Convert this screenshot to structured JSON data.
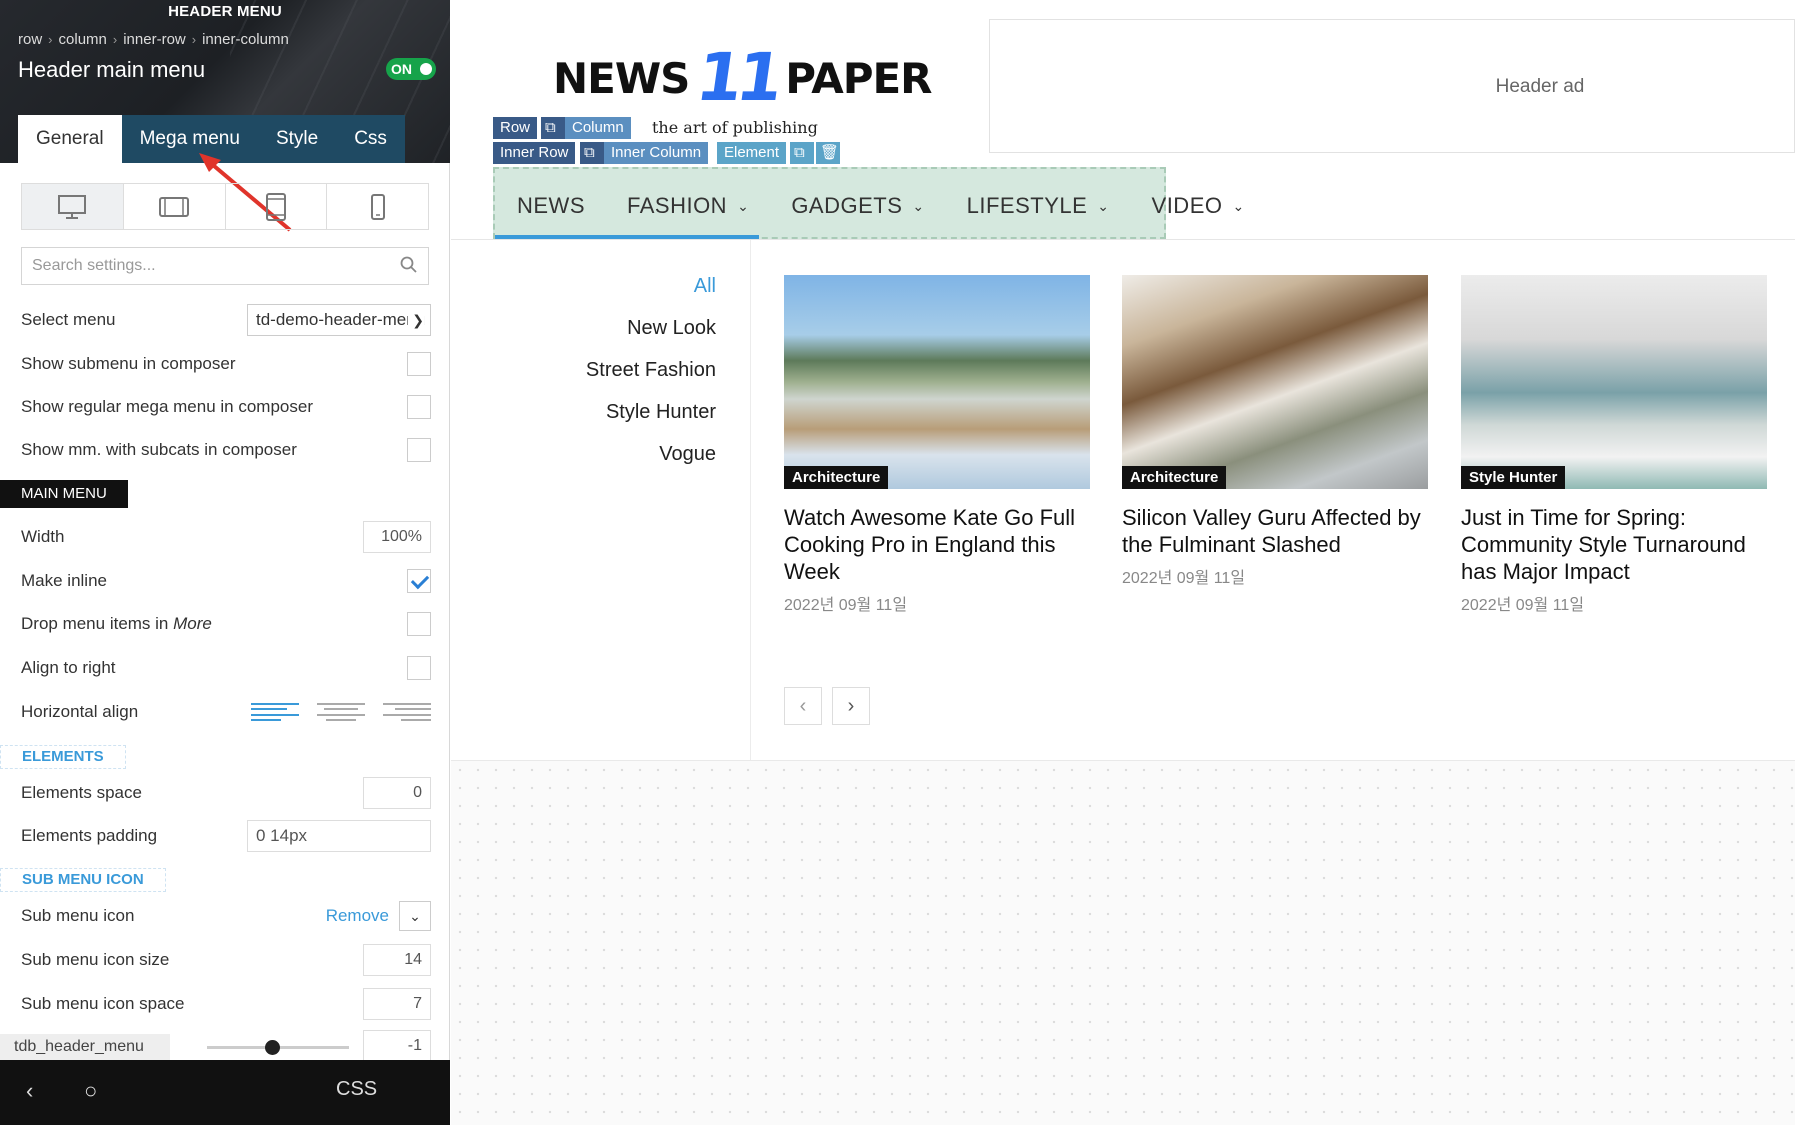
{
  "panel": {
    "header_title": "HEADER MENU",
    "breadcrumbs": [
      "row",
      "column",
      "inner-row",
      "inner-column"
    ],
    "element_name": "Header main menu",
    "toggle_label": "ON",
    "tabs": [
      {
        "label": "General",
        "active": true
      },
      {
        "label": "Mega menu",
        "active": false
      },
      {
        "label": "Style",
        "active": false
      },
      {
        "label": "Css",
        "active": false
      }
    ],
    "devices": [
      "desktop-icon",
      "tablet-landscape-icon",
      "tablet-portrait-icon",
      "phone-icon"
    ],
    "search_placeholder": "Search settings...",
    "select_menu": {
      "label": "Select menu",
      "value": "td-demo-header-menu"
    },
    "show_submenu": {
      "label": "Show submenu in composer",
      "checked": false
    },
    "show_regular_mega": {
      "label": "Show regular mega menu in composer",
      "checked": false
    },
    "show_mm_subcats": {
      "label": "Show mm. with subcats in composer",
      "checked": false
    },
    "section_main": "MAIN MENU",
    "width": {
      "label": "Width",
      "value": "100%"
    },
    "make_inline": {
      "label": "Make inline",
      "checked": true
    },
    "drop_menu_label": "Drop menu items in",
    "drop_menu_more": "More",
    "drop_menu_checked": false,
    "align_right": {
      "label": "Align to right",
      "checked": false
    },
    "horizontal_align": {
      "label": "Horizontal align",
      "selected": "left"
    },
    "section_elements": "ELEMENTS",
    "elements_space": {
      "label": "Elements space",
      "value": "0"
    },
    "elements_padding": {
      "label": "Elements padding",
      "value": "0 14px"
    },
    "section_submenu_icon": "SUB MENU ICON",
    "sub_menu_icon": {
      "label": "Sub menu icon",
      "action": "Remove"
    },
    "sub_menu_icon_size": {
      "label": "Sub menu icon size",
      "value": "14"
    },
    "sub_menu_icon_space": {
      "label": "Sub menu icon space",
      "value": "7"
    },
    "slider_value": "-1",
    "shortcode": "tdb_header_menu",
    "bottom_css": "CSS"
  },
  "preview": {
    "logo_left": "NEWS",
    "logo_mid": "11",
    "logo_right": "PAPER",
    "tagline": "the art of publishing",
    "header_ad": "Header ad",
    "composer_chips": {
      "row": "Row",
      "column": "Column",
      "inner_row": "Inner Row",
      "inner_column": "Inner Column",
      "element": "Element"
    },
    "menu": [
      {
        "label": "NEWS",
        "has_dropdown": false
      },
      {
        "label": "FASHION",
        "has_dropdown": true
      },
      {
        "label": "GADGETS",
        "has_dropdown": true
      },
      {
        "label": "LIFESTYLE",
        "has_dropdown": true
      },
      {
        "label": "VIDEO",
        "has_dropdown": true
      }
    ],
    "subcategories": [
      "All",
      "New Look",
      "Street Fashion",
      "Style Hunter",
      "Vogue"
    ],
    "active_subcategory": "All",
    "cards": [
      {
        "category": "Architecture",
        "title": "Watch Awesome Kate Go Full Cooking Pro in England this Week",
        "date": "2022년 09월 11일"
      },
      {
        "category": "Architecture",
        "title": "Silicon Valley Guru Affected by the Fulminant Slashed",
        "date": "2022년 09월 11일"
      },
      {
        "category": "Style Hunter",
        "title": "Just in Time for Spring: Community Style Turnaround has Major Impact",
        "date": "2022년 09월 11일"
      }
    ],
    "pager_prev": "‹",
    "pager_next": "›"
  },
  "colors": {
    "accent": "#3a9ad9",
    "tab_bg": "#1f4a63",
    "toggle_on": "#16a34a",
    "menu_bg": "#d5e8de",
    "logo_blue": "#2b6ff0"
  }
}
